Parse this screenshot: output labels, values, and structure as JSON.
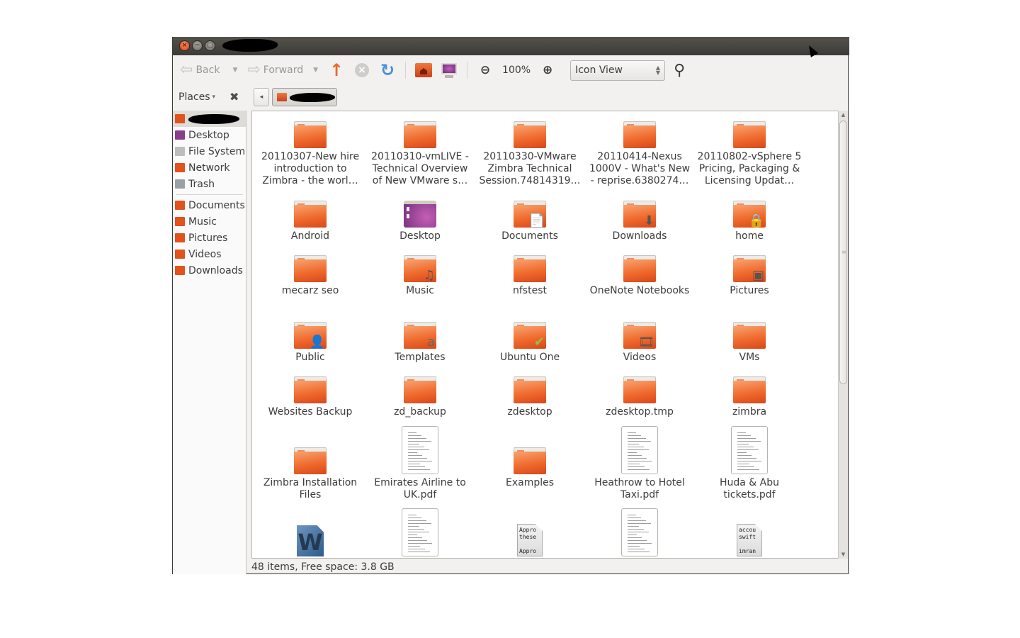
{
  "window": {
    "title_redacted": true,
    "controls": {
      "close": "×",
      "minimize": "−",
      "maximize": "□"
    }
  },
  "toolbar": {
    "back_label": "Back",
    "forward_label": "Forward",
    "back_arrow": "⇦",
    "forward_arrow": "⇨",
    "dropdown_glyph": "▼",
    "up_glyph": "🡅",
    "stop_glyph": "×",
    "reload_glyph": "↻",
    "zoom_out_glyph": "⊖",
    "zoom_in_glyph": "⊕",
    "zoom_level": "100%",
    "view_mode": "Icon View",
    "search_glyph": "🔍"
  },
  "sidebar": {
    "header_label": "Places",
    "header_dropdown": "▾",
    "close_glyph": "✖",
    "items": [
      {
        "label": "",
        "icon": "home-folder-icon",
        "color": "#e2521c",
        "selected": true,
        "redacted": true
      },
      {
        "label": "Desktop",
        "icon": "desktop-icon",
        "color": "#8a3c8f"
      },
      {
        "label": "File System",
        "icon": "harddisk-icon",
        "color": "#bdbdbd"
      },
      {
        "label": "Network",
        "icon": "network-folder-icon",
        "color": "#e2521c"
      },
      {
        "label": "Trash",
        "icon": "trash-icon",
        "color": "#9aa1a6"
      }
    ],
    "bookmarks": [
      {
        "label": "Documents",
        "icon": "documents-folder-icon",
        "color": "#e2521c"
      },
      {
        "label": "Music",
        "icon": "music-folder-icon",
        "color": "#e2521c"
      },
      {
        "label": "Pictures",
        "icon": "pictures-folder-icon",
        "color": "#e2521c"
      },
      {
        "label": "Videos",
        "icon": "videos-folder-icon",
        "color": "#e2521c"
      },
      {
        "label": "Downloads",
        "icon": "downloads-folder-icon",
        "color": "#e2521c"
      }
    ]
  },
  "pathbar": {
    "back_glyph": "◂",
    "current_redacted": true
  },
  "files": [
    {
      "name": "20110307-New hire introduction to Zimbra - the worl…",
      "type": "folder"
    },
    {
      "name": "20110310-vmLIVE - Technical Overview of New VMware s…",
      "type": "folder"
    },
    {
      "name": "20110330-VMware Zimbra Technical Session.74814319…",
      "type": "folder"
    },
    {
      "name": "20110414-Nexus 1000V - What's New - reprise.6380274…",
      "type": "folder"
    },
    {
      "name": "20110802-vSphere 5 Pricing, Packaging & Licensing Updat…",
      "type": "folder"
    },
    {
      "name": "Android",
      "type": "folder"
    },
    {
      "name": "Desktop",
      "type": "desktop"
    },
    {
      "name": "Documents",
      "type": "folder",
      "emblem": "📄"
    },
    {
      "name": "Downloads",
      "type": "folder",
      "emblem": "⬇"
    },
    {
      "name": "home",
      "type": "folder",
      "emblem": "🔒"
    },
    {
      "name": "mecarz seo",
      "type": "folder"
    },
    {
      "name": "Music",
      "type": "folder",
      "emblem": "♫"
    },
    {
      "name": "nfstest",
      "type": "folder"
    },
    {
      "name": "OneNote Notebooks",
      "type": "folder"
    },
    {
      "name": "Pictures",
      "type": "folder",
      "emblem": "▣"
    },
    {
      "name": "Public",
      "type": "folder",
      "emblem": "👤"
    },
    {
      "name": "Templates",
      "type": "folder",
      "emblem": "a"
    },
    {
      "name": "Ubuntu One",
      "type": "folder",
      "emblem": "✔"
    },
    {
      "name": "Videos",
      "type": "folder",
      "emblem": "🎞"
    },
    {
      "name": "VMs",
      "type": "folder"
    },
    {
      "name": "Websites Backup",
      "type": "folder"
    },
    {
      "name": "zd_backup",
      "type": "folder"
    },
    {
      "name": "zdesktop",
      "type": "folder"
    },
    {
      "name": "zdesktop.tmp",
      "type": "folder"
    },
    {
      "name": "zimbra",
      "type": "folder"
    },
    {
      "name": "Zimbra Installation Files",
      "type": "folder"
    },
    {
      "name": "Emirates Airline to UK.pdf",
      "type": "pdf"
    },
    {
      "name": "Examples",
      "type": "folder"
    },
    {
      "name": "Heathrow to Hotel Taxi.pdf",
      "type": "pdf"
    },
    {
      "name": "Huda & Abu tickets.pdf",
      "type": "pdf"
    },
    {
      "name": "",
      "type": "word",
      "glyph": "W"
    },
    {
      "name": "",
      "type": "pdf"
    },
    {
      "name": "",
      "type": "text",
      "preview": [
        "Appro",
        "these",
        "",
        "Appro"
      ]
    },
    {
      "name": "",
      "type": "pdf"
    },
    {
      "name": "",
      "type": "text",
      "preview": [
        "accou",
        "swift",
        "",
        "imran"
      ]
    }
  ],
  "statusbar": {
    "text": "48 items, Free space: 3.8 GB"
  },
  "scrollbar": {
    "up_glyph": "▲",
    "down_glyph": "▼",
    "position_fraction": 0.0,
    "visible_fraction": 0.6
  }
}
